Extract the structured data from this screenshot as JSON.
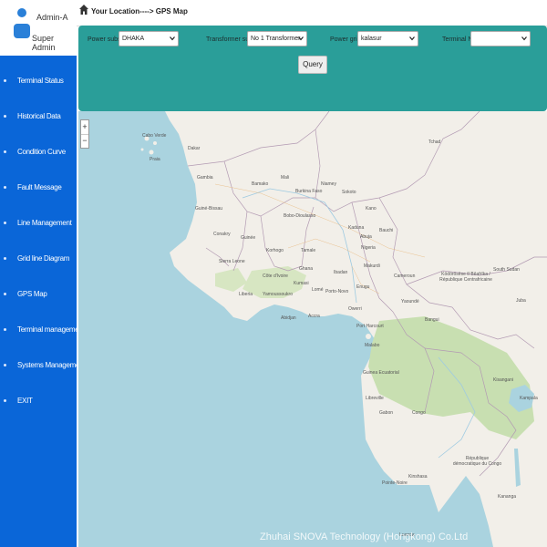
{
  "user": {
    "name": "Admin-A",
    "role": "Super Admin"
  },
  "nav": [
    {
      "label": "Terminal Status"
    },
    {
      "label": "Historical Data"
    },
    {
      "label": "Condition Curve"
    },
    {
      "label": "Fault Message"
    },
    {
      "label": "Line Management"
    },
    {
      "label": "Grid line Diagram"
    },
    {
      "label": "GPS Map"
    },
    {
      "label": "Terminal management"
    },
    {
      "label": "Systems Management"
    },
    {
      "label": "EXIT"
    }
  ],
  "breadcrumb": "Your Location----> GPS Map",
  "filters": {
    "power_substation": {
      "label": "Power substation",
      "value": "DHAKA"
    },
    "transformer_substation": {
      "label": "Transformer substation",
      "value": "No 1 Transformer"
    },
    "power_grid_line": {
      "label": "Power grid Line",
      "value": "kalasur"
    },
    "terminal_name": {
      "label": "Terminal Name",
      "value": ""
    },
    "query_label": "Query"
  },
  "map": {
    "zoom_in": "+",
    "zoom_out": "−",
    "labels": {
      "cabo_verde": "Cabo Verde",
      "praia": "Praia",
      "dakar": "Dakar",
      "gambia": "Gambia",
      "guine_bissau": "Guiné-Bissau",
      "mali": "Mali",
      "niamey": "Niamey",
      "bamako": "Bamako",
      "burkina_faso": "Burkina Faso",
      "bobo_dioulasso": "Bobo-Dioulasso",
      "sokoto": "Sokoto",
      "kano": "Kano",
      "kaduna": "Kaduna",
      "bauchi": "Bauchi",
      "conakry": "Conakry",
      "guinee": "Guinée",
      "sierra_leone": "Sierra Leone",
      "liberia": "Liberia",
      "korhogo": "Korhogo",
      "tamale": "Tamale",
      "cote_divoire": "Côte d'Ivoire",
      "ghana": "Ghana",
      "yamoussoukro": "Yamoussoukro",
      "kumasi": "Kumasi",
      "abidjan": "Abidjan",
      "accra": "Accra",
      "lome": "Lomé",
      "porto_novo": "Porto-Novo",
      "ibadan": "Ibadan",
      "nigeria": "Nigeria",
      "abuja": "Abuja",
      "makurdi": "Makurdi",
      "enugu": "Enugu",
      "owerri": "Owerri",
      "port_harcourt": "Port Harcourt",
      "malabo": "Malabo",
      "cameroun": "Cameroun",
      "yaounde": "Yaoundé",
      "bangui": "Bangui",
      "tchad": "Tchad",
      "car": "Ködörösêse tî Bêafrîka / République Centrafricaine",
      "south_sudan": "South Sudan",
      "juba": "Juba",
      "guinea_ecuatorial": "Guinea Ecuatorial",
      "libreville": "Libreville",
      "gabon": "Gabon",
      "congo": "Congo",
      "kisangani": "Kisangani",
      "kampala": "Kampala",
      "rdc": "République démocratique du Congo",
      "pointe_noire": "Pointe-Noire",
      "kinshasa": "Kinshasa",
      "kananga": "Kananga",
      "luanda": "Luanda"
    }
  },
  "watermark": "Zhuhai SNOVA Technology (Hongkong) Co.Ltd"
}
